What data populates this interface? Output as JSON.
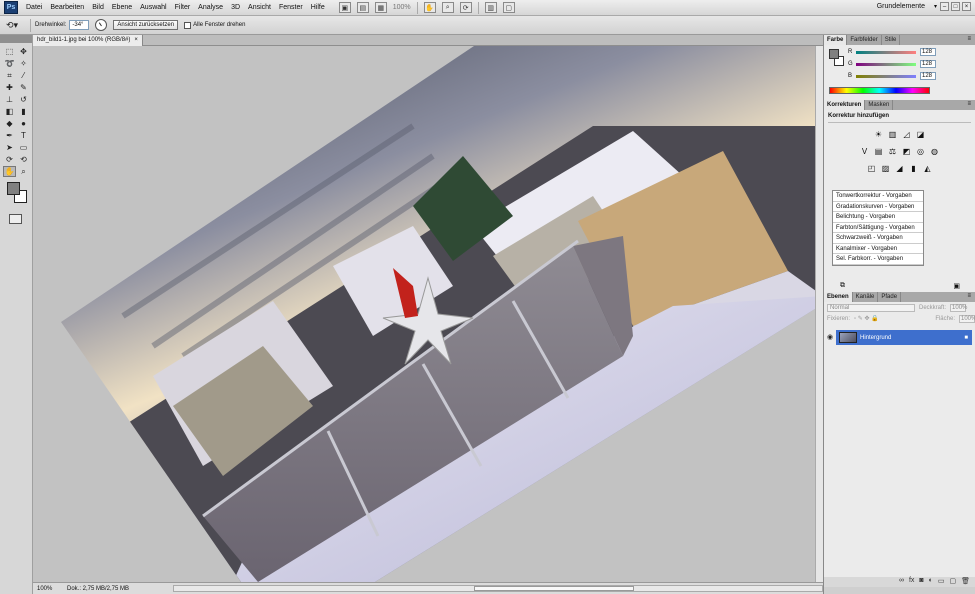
{
  "app": {
    "logo": "Ps"
  },
  "menu": [
    "Datei",
    "Bearbeiten",
    "Bild",
    "Ebene",
    "Auswahl",
    "Filter",
    "Analyse",
    "3D",
    "Ansicht",
    "Fenster",
    "Hilfe"
  ],
  "menubar": {
    "zoom": "100%",
    "workspace": "Grundelemente"
  },
  "options": {
    "angle_label": "Drehwinkel:",
    "angle_value": "-34°",
    "reset_button": "Ansicht zurücksetzen",
    "rotate_all_label": "Alle Fenster drehen"
  },
  "document": {
    "tab_title": "hdr_bild1-1.jpg bei 100% (RGB/8#)",
    "tab_close": "×"
  },
  "status": {
    "zoom": "100%",
    "doc_info": "Dok.: 2,75 MB/2,75 MB"
  },
  "color_panel": {
    "tabs": [
      "Farbe",
      "Farbfelder",
      "Stile"
    ],
    "channels": [
      {
        "label": "R",
        "value": "128"
      },
      {
        "label": "G",
        "value": "128"
      },
      {
        "label": "B",
        "value": "128"
      }
    ],
    "colors": {
      "foreground": "#808080",
      "background": "#ffffff"
    }
  },
  "adjust_panel": {
    "tabs": [
      "Korrekturen",
      "Masken"
    ],
    "title": "Korrektur hinzufügen",
    "presets": [
      "Tonwertkorrektur - Vorgaben",
      "Gradationskurven - Vorgaben",
      "Belichtung - Vorgaben",
      "Farbton/Sättigung - Vorgaben",
      "Schwarzweiß - Vorgaben",
      "Kanalmixer - Vorgaben",
      "Sel. Farbkorr. - Vorgaben"
    ]
  },
  "layers_panel": {
    "tabs": [
      "Ebenen",
      "Kanäle",
      "Pfade"
    ],
    "blend_mode": "Normal",
    "opacity_label": "Deckkraft:",
    "opacity_value": "100%",
    "fix_label": "Fixieren:",
    "fill_label": "Fläche:",
    "fill_value": "100%",
    "layer_name": "Hintergrund"
  }
}
